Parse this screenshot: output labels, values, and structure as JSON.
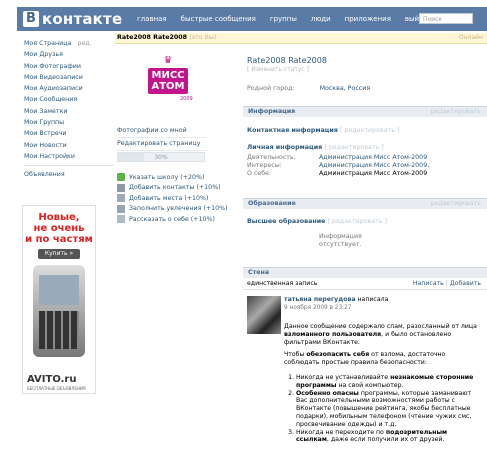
{
  "topbar": {
    "logo_letter": "В",
    "logo_text": "контакте",
    "nav": [
      "главная",
      "быстрые сообщения",
      "группы",
      "люди",
      "приложения",
      "выйти"
    ],
    "search_placeholder": "Поиск"
  },
  "sidebar": {
    "items": [
      "Мои Друзья",
      "Мои Фотографии",
      "Мои Видеозаписи",
      "Мои Аудиозаписи",
      "Мои Сообщения",
      "Мои Заметки",
      "Мои Группы",
      "Мои Встречи",
      "Мои Новости",
      "Мои Настройки"
    ],
    "my_page": "Моя Страница",
    "my_page_edit": "ред.",
    "ads": "Объявления"
  },
  "ad": {
    "line1": "Новые,",
    "line2": "не очень",
    "line3": "и по частям",
    "button": "Купить »",
    "brand": "AVITO.ru",
    "brand_sub": "БЕСПЛАТНЫЕ ОБЪЯВЛЕНИЯ"
  },
  "header": {
    "name": "Rate2008 Rate2008",
    "status": "(это Вы)",
    "online": "Онлайн"
  },
  "photo": {
    "line1": "МИСС",
    "line2": "АТОМ",
    "year": "2009"
  },
  "left_links": [
    "Фотографии со мной",
    "Редактировать страницу"
  ],
  "progress": {
    "label": "30%",
    "value": 0.3
  },
  "tips": [
    "Указать школу (+20%)",
    "Добавить контакты (+10%)",
    "Добавить места (+10%)",
    "Заполнить увлечения (+10%)",
    "Рассказать о себе (+10%)"
  ],
  "profile": {
    "name": "Rate2008 Rate2008",
    "status_edit": "[ Изменить статус ]",
    "hometown_label": "Родной город:",
    "hometown_value": "Москва, Россия"
  },
  "info": {
    "title": "Информация",
    "edit": "редактировать",
    "contact_title": "Контактная информация",
    "contact_edit": "[ редактировать ]",
    "personal_title": "Личная информация",
    "personal_edit": "[ редактировать ]",
    "activity_label": "Деятельность:",
    "activity_value": "Администрация Мисс Атом-2009",
    "interests_label": "Интересы:",
    "interests_value": "Администрация Мисс Атом-2009,",
    "about_label": "О себе:",
    "about_value": "Администрация Мисс Атом-2009"
  },
  "education": {
    "title": "Образование",
    "edit": "редактировать",
    "higher_title": "Высшее образование",
    "higher_edit": "[ редактировать ]",
    "info_line1": "Информация",
    "info_line2": "отсутствует."
  },
  "wall": {
    "title": "Стена",
    "count": "единственная запись",
    "write": "Написать",
    "sep": "|",
    "add": "Добавить",
    "author": "татьяна перегудова",
    "wrote": "написала",
    "date": "9 ноября 2009 в 23:27",
    "p1_a": "Данное сообщение содержало спам, разосланный от лица ",
    "p1_b": "взломанного пользователя",
    "p1_c": ", и было остановлено фильтрами ВКонтакте.",
    "p2_a": "Чтобы ",
    "p2_b": "обезопасить себя",
    "p2_c": " от взлома, достаточно соблюдать простые правила безопасности:",
    "l1_a": "Никогда не устанавливайте ",
    "l1_b": "незнакомые сторонние программы",
    "l1_c": " на свой компьютер.",
    "l2_a": "Особенно опасны",
    "l2_b": " программы, которые заманивают Вас дополнительными возможностями работы с ВКонтакте (повышение рейтинга, якобы бесплатные подарки), мобильным телефоном (чтение чужих смс, просвечивание одежды) и т.д.",
    "l3_a": "Никогда не переходите по ",
    "l3_b": "подозрительным ссылкам",
    "l3_c": ", даже если получили их от друзей."
  }
}
